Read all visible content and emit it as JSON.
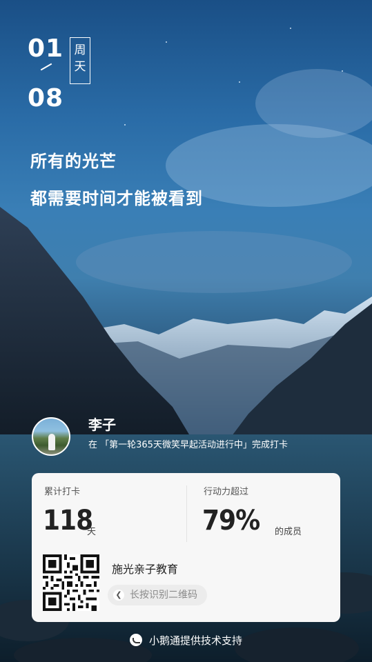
{
  "date": {
    "day": "01",
    "month": "08",
    "weekday": [
      "周",
      "天"
    ]
  },
  "quote": {
    "line1": "所有的光芒",
    "line2": "都需要时间才能被看到"
  },
  "user": {
    "name": "李子",
    "checkin_text": "在 「第一轮365天微笑早起活动进行中」完成打卡"
  },
  "stats": {
    "total_label": "累计打卡",
    "total_value": "118",
    "total_unit": "天",
    "action_label": "行动力超过",
    "action_value": "79%",
    "action_unit": "的成员"
  },
  "org": {
    "name": "施光亲子教育",
    "qr_hint": "长按识别二维码"
  },
  "footer": {
    "text": "小鹅通提供技术支持"
  },
  "colors": {
    "card_bg": "#f7f7f7",
    "text_dark": "#222222",
    "hint_bg": "#ececec"
  }
}
